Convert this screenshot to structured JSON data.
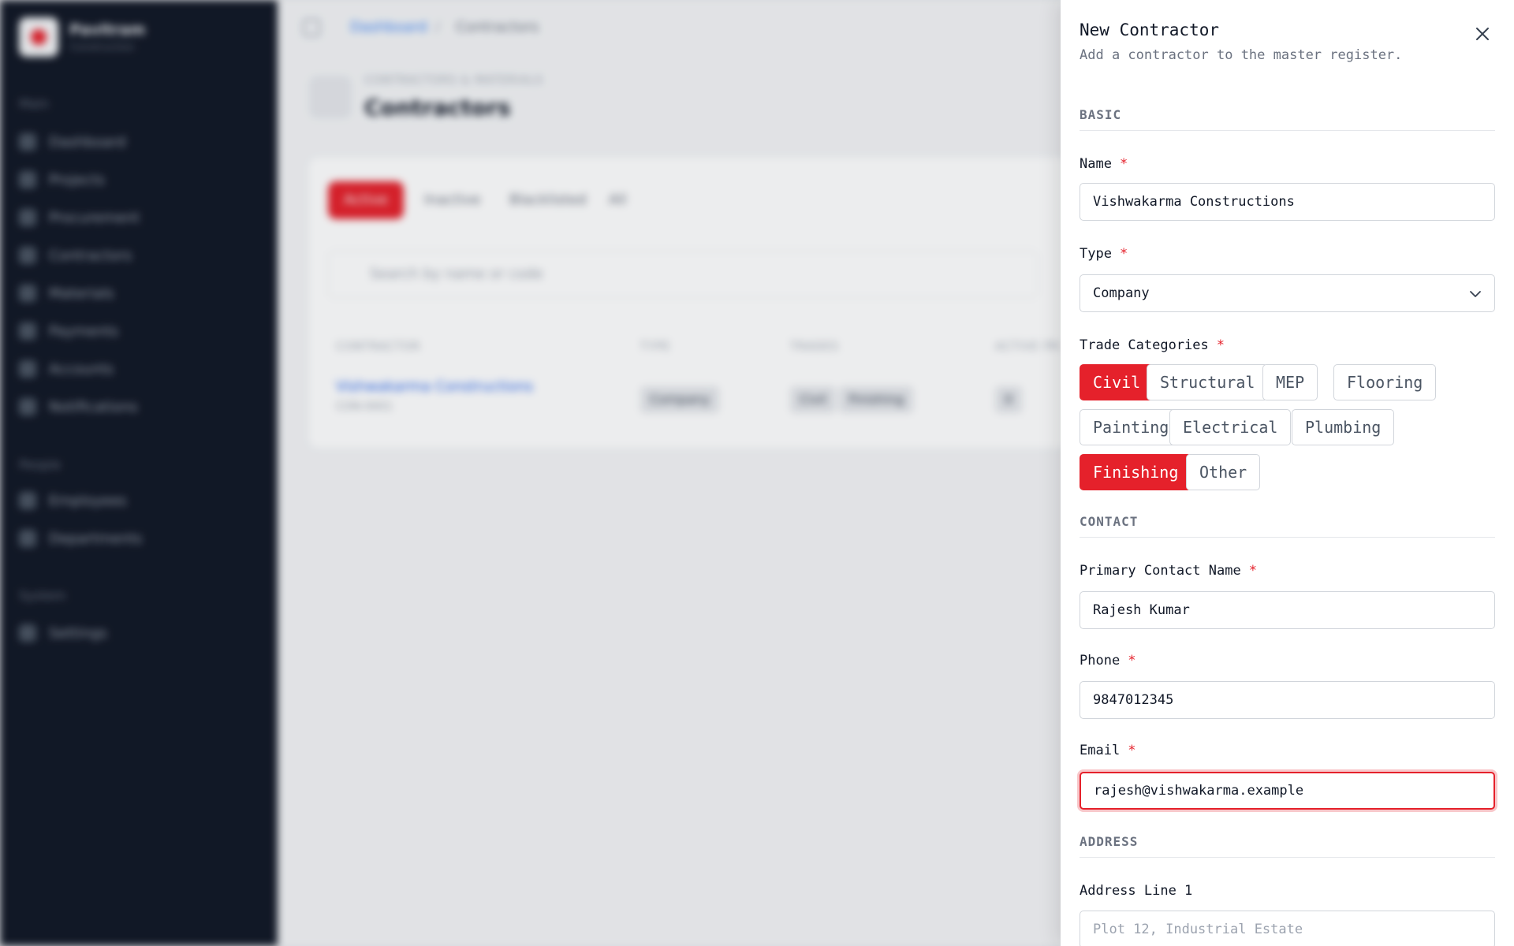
{
  "sidebar": {
    "brand_name": "Pavitram",
    "brand_sub": "Construction",
    "sections": {
      "main": "Main",
      "people": "People",
      "system": "System"
    },
    "items": [
      {
        "label": "Dashboard"
      },
      {
        "label": "Projects"
      },
      {
        "label": "Procurement"
      },
      {
        "label": "Contractors"
      },
      {
        "label": "Materials"
      },
      {
        "label": "Payments"
      },
      {
        "label": "Accounts"
      },
      {
        "label": "Notifications"
      },
      {
        "label": "Employees"
      },
      {
        "label": "Departments"
      },
      {
        "label": "Settings"
      }
    ]
  },
  "breadcrumb": {
    "parent": "Dashboard",
    "separator": "/",
    "current": "Contractors"
  },
  "header": {
    "eyebrow": "CONTRACTORS & MATERIALS",
    "title": "Contractors"
  },
  "tabs": [
    {
      "label": "Active"
    },
    {
      "label": "Inactive"
    },
    {
      "label": "Blacklisted"
    },
    {
      "label": "All"
    }
  ],
  "search": {
    "placeholder": "Search by name or code"
  },
  "table": {
    "columns": [
      "CONTRACTOR",
      "TYPE",
      "TRADES",
      "ACTIVE PR"
    ],
    "rows": [
      {
        "name": "Vishwakarma Constructions",
        "code": "CON-0001",
        "type": "Company",
        "trades": [
          "Civil",
          "Finishing"
        ],
        "active": "0"
      }
    ]
  },
  "drawer": {
    "title": "New Contractor",
    "subtitle": "Add a contractor to the master register.",
    "sections": {
      "basic": "BASIC",
      "contact": "CONTACT",
      "address": "ADDRESS"
    },
    "required_mark": "*",
    "fields": {
      "name": {
        "label": "Name",
        "value": "Vishwakarma Constructions"
      },
      "type": {
        "label": "Type",
        "value": "Company"
      },
      "trade_categories": {
        "label": "Trade Categories"
      },
      "primary_contact": {
        "label": "Primary Contact Name",
        "value": "Rajesh Kumar"
      },
      "phone": {
        "label": "Phone",
        "value": "9847012345"
      },
      "email": {
        "label": "Email",
        "value": "rajesh@vishwakarma.example"
      },
      "address_line1": {
        "label": "Address Line 1",
        "placeholder": "Plot 12, Industrial Estate"
      }
    },
    "trades": [
      {
        "label": "Civil",
        "selected": true
      },
      {
        "label": "Structural",
        "selected": false
      },
      {
        "label": "MEP",
        "selected": false
      },
      {
        "label": "Flooring",
        "selected": false
      },
      {
        "label": "Painting",
        "selected": false
      },
      {
        "label": "Electrical",
        "selected": false
      },
      {
        "label": "Plumbing",
        "selected": false
      },
      {
        "label": "Finishing",
        "selected": true
      },
      {
        "label": "Other",
        "selected": false
      }
    ]
  },
  "colors": {
    "accent": "#e5212b",
    "sidebar_bg": "#121826"
  }
}
